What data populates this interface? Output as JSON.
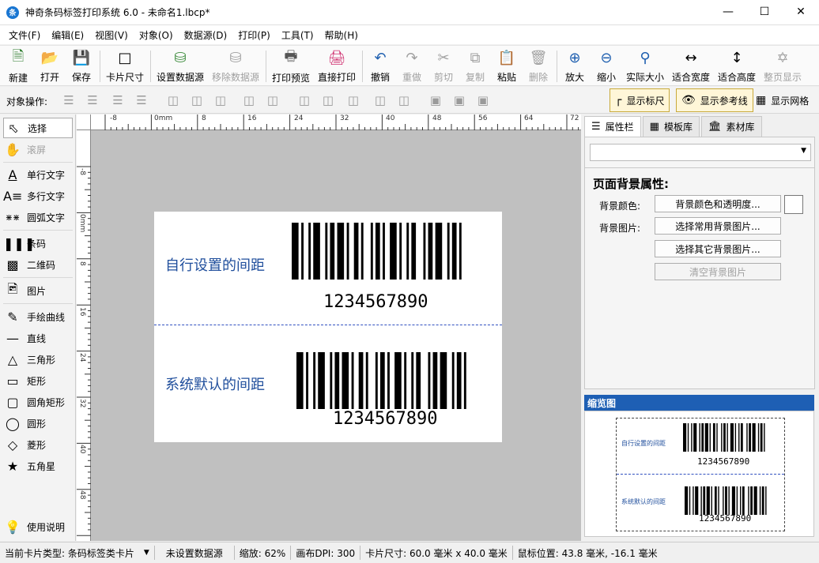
{
  "window": {
    "title": "神奇条码标签打印系统 6.0 - 未命名1.lbcp*",
    "app_icon": "条"
  },
  "menu": [
    "文件(F)",
    "编辑(E)",
    "视图(V)",
    "对象(O)",
    "数据源(D)",
    "打印(P)",
    "工具(T)",
    "帮助(H)"
  ],
  "toolbar": [
    {
      "label": "新建",
      "icon": "new-file-icon"
    },
    {
      "label": "打开",
      "icon": "open-icon"
    },
    {
      "label": "保存",
      "icon": "save-icon"
    },
    {
      "label": "卡片尺寸",
      "icon": "card-size-icon"
    },
    {
      "label": "设置数据源",
      "icon": "database-icon"
    },
    {
      "label": "移除数据源",
      "icon": "database-remove-icon",
      "disabled": true
    },
    {
      "label": "打印预览",
      "icon": "print-preview-icon"
    },
    {
      "label": "直接打印",
      "icon": "printer-icon"
    },
    {
      "label": "撤销",
      "icon": "undo-icon"
    },
    {
      "label": "重做",
      "icon": "redo-icon",
      "disabled": true
    },
    {
      "label": "剪切",
      "icon": "cut-icon",
      "disabled": true
    },
    {
      "label": "复制",
      "icon": "copy-icon",
      "disabled": true
    },
    {
      "label": "粘贴",
      "icon": "paste-icon"
    },
    {
      "label": "删除",
      "icon": "delete-icon",
      "disabled": true
    },
    {
      "label": "放大",
      "icon": "zoom-in-icon"
    },
    {
      "label": "缩小",
      "icon": "zoom-out-icon"
    },
    {
      "label": "实际大小",
      "icon": "actual-size-icon"
    },
    {
      "label": "适合宽度",
      "icon": "fit-width-icon"
    },
    {
      "label": "适合高度",
      "icon": "fit-height-icon"
    },
    {
      "label": "整页显示",
      "icon": "full-page-icon",
      "disabled": true
    }
  ],
  "objbar": {
    "label": "对象操作:",
    "show_ruler": "显示标尺",
    "show_guides": "显示参考线",
    "show_grid": "显示网格"
  },
  "tools": {
    "select": "选择",
    "scroll": "滚屏",
    "single_text": "单行文字",
    "multi_text": "多行文字",
    "arc_text": "圆弧文字",
    "barcode": "条码",
    "qrcode": "二维码",
    "image": "图片",
    "freehand": "手绘曲线",
    "line": "直线",
    "triangle": "三角形",
    "rect": "矩形",
    "round_rect": "圆角矩形",
    "circle": "圆形",
    "diamond": "菱形",
    "star": "五角星",
    "help": "使用说明"
  },
  "ruler": {
    "h_ticks": [
      "-8",
      "0mm",
      "8",
      "16",
      "24",
      "32",
      "40",
      "48",
      "56",
      "64",
      "72"
    ],
    "v_ticks": [
      "-8",
      "0mm",
      "8",
      "16",
      "24",
      "32",
      "40",
      "48"
    ]
  },
  "card": {
    "label_top": "自行设置的间距",
    "label_bottom": "系统默认的间距",
    "barcode_top": "1234567890",
    "barcode_bottom": "1234567890"
  },
  "right_panel": {
    "tabs": [
      "属性栏",
      "模板库",
      "素材库"
    ],
    "heading": "页面背景属性:",
    "bg_color_label": "背景颜色:",
    "bg_image_label": "背景图片:",
    "btn_color": "背景颜色和透明度...",
    "btn_common_img": "选择常用背景图片...",
    "btn_other_img": "选择其它背景图片...",
    "btn_clear_img": "清空背景图片",
    "overview_title": "缩览图"
  },
  "status": {
    "card_type": "当前卡片类型:  条码标签类卡片",
    "datasource": "未设置数据源",
    "zoom": "缩放:  62%",
    "dpi": "画布DPI:  300",
    "card_size": "卡片尺寸:  60.0 毫米 x 40.0 毫米",
    "mouse_pos": "鼠标位置:  43.8 毫米,  -16.1 毫米"
  },
  "colors": {
    "accent": "#1e5fb4",
    "label_text": "#1f4e9c",
    "toggle_bg": "#fff6d8"
  }
}
